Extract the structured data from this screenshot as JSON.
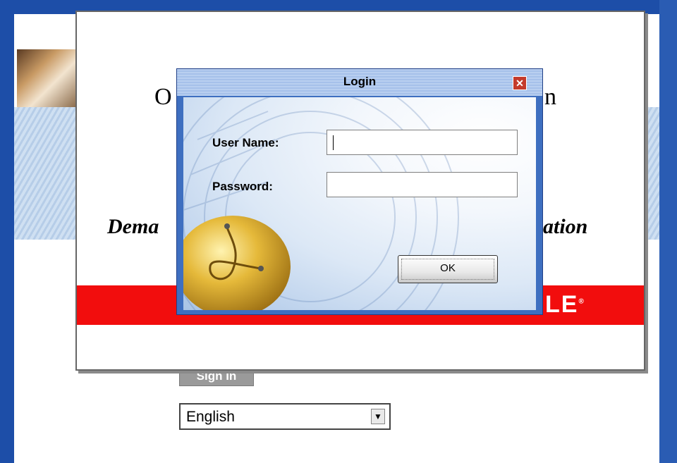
{
  "background_page": {
    "signin_label": "Sign In",
    "language_select": {
      "value": "English"
    }
  },
  "splash": {
    "title_left": "O",
    "title_right": "n",
    "tagline_left": "Dema",
    "tagline_right": "ation",
    "brand_logo_fragment": "LE"
  },
  "login_dialog": {
    "title": "Login",
    "username_label": "User Name:",
    "username_value": "",
    "password_label": "Password:",
    "password_value": "",
    "ok_label": "OK",
    "close_glyph": "✕"
  },
  "icons": [
    "close-icon",
    "dropdown-arrow-icon",
    "app-logo-icon"
  ],
  "colors": {
    "dialog_frame": "#3e6fc0",
    "splash_red": "#f20d0d",
    "desktop_blue": "#1d4ea8"
  }
}
